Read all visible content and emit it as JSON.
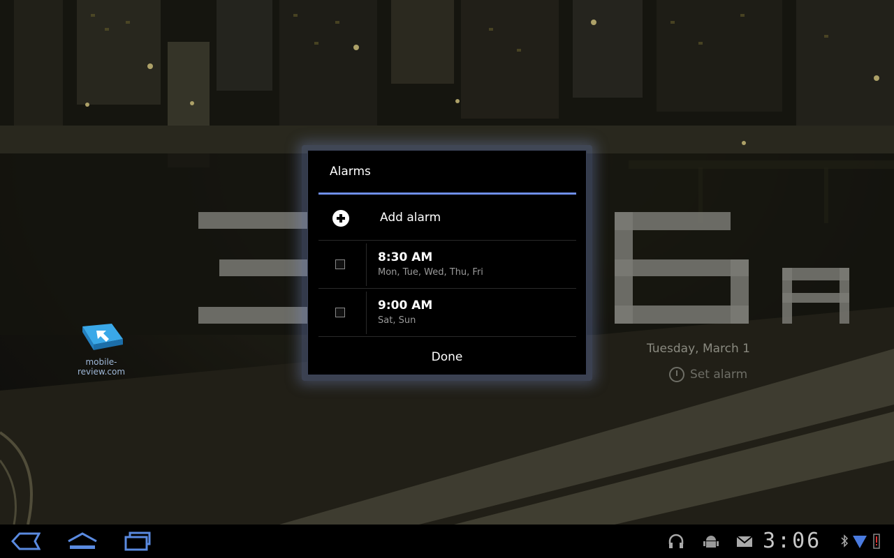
{
  "dialog": {
    "title": "Alarms",
    "add_label": "Add alarm",
    "alarms": [
      {
        "time": "8:30 AM",
        "days": "Mon, Tue, Wed, Thu, Fri",
        "enabled": false
      },
      {
        "time": "9:00 AM",
        "days": "Sat, Sun",
        "enabled": false
      }
    ],
    "done_label": "Done"
  },
  "clock_widget": {
    "date": "Tuesday, March 1",
    "set_alarm_label": "Set alarm"
  },
  "watermark": {
    "text": "mobile-review.com"
  },
  "system_bar": {
    "time": "3:06",
    "nav": [
      "back-icon",
      "home-icon",
      "recent-apps-icon"
    ],
    "status_icons": [
      "headphones-icon",
      "android-debug-icon",
      "email-icon",
      "bluetooth-icon",
      "wifi-icon",
      "battery-icon"
    ]
  },
  "colors": {
    "accent": "#6f8fea",
    "dialog_bg": "#000000",
    "battery_low": "#e03030"
  }
}
